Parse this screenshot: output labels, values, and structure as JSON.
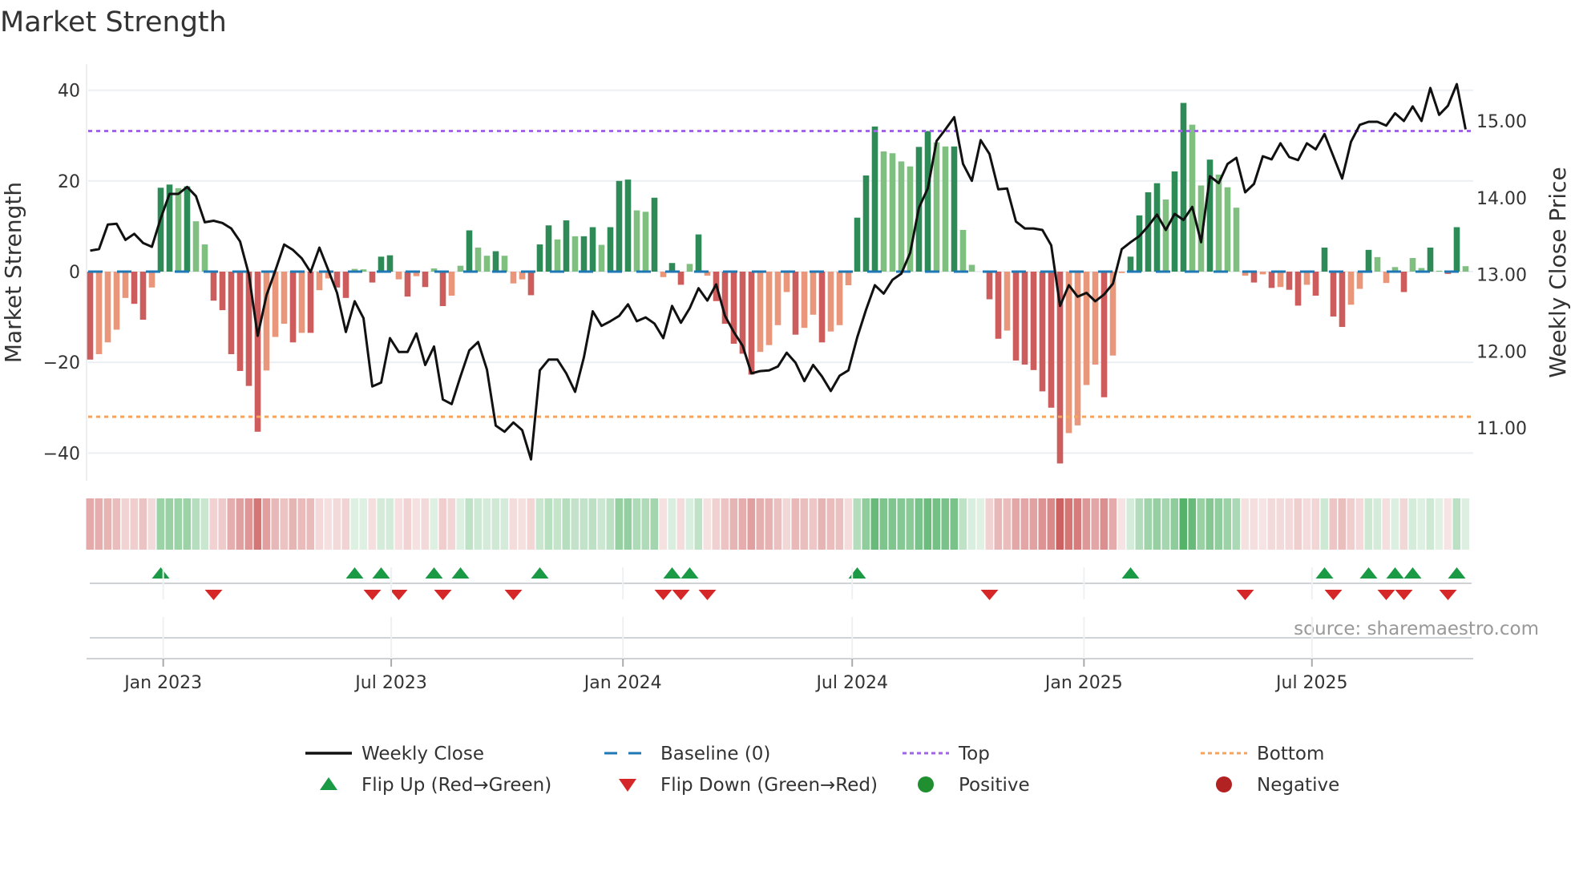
{
  "chart_data": {
    "type": "bar",
    "title": "Market Strength",
    "ylabel": "Market Strength",
    "y2label": "Weekly Close Price",
    "start_date": "2022-11-04",
    "frequency": "weekly",
    "ylim": [
      -46,
      46
    ],
    "y2lim": [
      10.45,
      15.55
    ],
    "yticks": [
      40,
      20,
      0,
      -20,
      -40
    ],
    "ytick_labels": [
      "40",
      "20",
      "0",
      "−20",
      "−40"
    ],
    "y2ticks": [
      15,
      14,
      13,
      12,
      11
    ],
    "y2tick_labels": [
      "15.00",
      "14.00",
      "13.00",
      "12.00",
      "11.00"
    ],
    "xtick_dates": [
      "2023-01-01",
      "2023-07-01",
      "2024-01-01",
      "2024-07-01",
      "2025-01-01",
      "2025-07-01"
    ],
    "xtick_labels": [
      "Jan 2023",
      "Jul 2023",
      "Jan 2024",
      "Jul 2024",
      "Jan 2025",
      "Jul 2025"
    ],
    "top_level": 31,
    "bottom_level": -32,
    "baseline": 0,
    "strength": [
      -19.4,
      -18.2,
      -15.6,
      -12.8,
      -5.8,
      -7.1,
      -10.6,
      -3.5,
      18.5,
      19.2,
      18.4,
      18.8,
      11.1,
      6.0,
      -6.4,
      -8.5,
      -18.2,
      -21.9,
      -25.2,
      -35.3,
      -21.8,
      -14.4,
      -11.5,
      -15.6,
      -13.5,
      -13.5,
      -4.1,
      -1.5,
      -3.5,
      -5.8,
      0.6,
      0.5,
      -2.4,
      3.3,
      3.6,
      -1.7,
      -5.5,
      -1.0,
      -3.4,
      0.7,
      -7.6,
      -5.3,
      1.3,
      9.1,
      5.3,
      3.5,
      4.5,
      3.5,
      -2.6,
      -1.7,
      -5.2,
      6.0,
      10.2,
      7.1,
      11.3,
      7.8,
      7.8,
      9.8,
      5.9,
      9.8,
      20.0,
      20.3,
      13.5,
      13.2,
      16.3,
      -1.2,
      1.9,
      -2.9,
      1.7,
      8.2,
      -0.9,
      -6.5,
      -11.5,
      -15.9,
      -18.1,
      -22.7,
      -17.7,
      -16.2,
      -11.8,
      -4.5,
      -13.9,
      -12.4,
      -9.5,
      -15.6,
      -13.2,
      -11.8,
      -3.0,
      11.9,
      21.2,
      32.0,
      26.5,
      26.1,
      24.3,
      23.2,
      27.5,
      31.0,
      28.5,
      27.6,
      27.6,
      9.2,
      1.5,
      0,
      -6.1,
      -14.8,
      -13.0,
      -19.6,
      -20.5,
      -21.7,
      -26.4,
      -30.0,
      -42.3,
      -35.6,
      -33.9,
      -25.0,
      -20.5,
      -27.7,
      -18.5,
      -0.3,
      3.3,
      12.4,
      17.5,
      19.5,
      15.9,
      22.1,
      37.2,
      32.4,
      19.0,
      24.7,
      21.4,
      18.6,
      14.1,
      -0.9,
      -2.4,
      -0.6,
      -3.6,
      -3.4,
      -4.0,
      -7.5,
      -2.9,
      -5.3,
      5.3,
      -9.9,
      -12.2,
      -7.3,
      -3.8,
      4.8,
      3.2,
      -2.5,
      1.0,
      -4.5,
      3.0,
      0.8,
      5.3,
      0.2,
      -0.5,
      9.8,
      1.2
    ],
    "weekly_close": [
      13.31,
      13.33,
      13.65,
      13.66,
      13.45,
      13.53,
      13.41,
      13.36,
      13.73,
      14.05,
      14.05,
      14.14,
      14.02,
      13.68,
      13.7,
      13.67,
      13.6,
      13.43,
      13.0,
      12.2,
      12.73,
      13.05,
      13.39,
      13.32,
      13.21,
      13.03,
      13.35,
      13.06,
      12.76,
      12.25,
      12.65,
      12.43,
      11.54,
      11.59,
      12.17,
      11.99,
      11.99,
      12.23,
      11.82,
      12.06,
      11.37,
      11.31,
      11.67,
      12.01,
      12.12,
      11.76,
      11.03,
      10.95,
      11.07,
      10.97,
      10.59,
      11.75,
      11.89,
      11.89,
      11.71,
      11.47,
      11.92,
      12.52,
      12.33,
      12.39,
      12.46,
      12.61,
      12.39,
      12.44,
      12.36,
      12.17,
      12.59,
      12.37,
      12.56,
      12.82,
      12.66,
      12.87,
      12.46,
      12.25,
      12.07,
      11.71,
      11.74,
      11.75,
      11.8,
      11.98,
      11.85,
      11.61,
      11.82,
      11.67,
      11.48,
      11.68,
      11.75,
      12.18,
      12.54,
      12.86,
      12.75,
      12.93,
      13.01,
      13.28,
      13.87,
      14.12,
      14.74,
      14.89,
      15.05,
      14.44,
      14.22,
      14.75,
      14.57,
      14.11,
      14.12,
      13.69,
      13.6,
      13.6,
      13.58,
      13.38,
      12.59,
      12.86,
      12.71,
      12.76,
      12.65,
      12.74,
      12.88,
      13.33,
      13.42,
      13.5,
      13.63,
      13.78,
      13.58,
      13.79,
      13.71,
      13.88,
      13.42,
      14.28,
      14.19,
      14.44,
      14.52,
      14.07,
      14.18,
      14.54,
      14.5,
      14.71,
      14.53,
      14.49,
      14.71,
      14.63,
      14.83,
      14.54,
      14.25,
      14.73,
      14.95,
      14.99,
      14.99,
      14.94,
      15.1,
      15.0,
      15.19,
      15.0,
      15.43,
      15.08,
      15.2,
      15.48,
      14.89
    ],
    "legend": {
      "placement": "bottom-center",
      "entries": [
        {
          "key": "weekly_close",
          "label": "Weekly Close"
        },
        {
          "key": "baseline",
          "label": "Baseline (0)"
        },
        {
          "key": "top",
          "label": "Top"
        },
        {
          "key": "bottom",
          "label": "Bottom"
        },
        {
          "key": "flip_up",
          "label": "Flip Up (Red→Green)"
        },
        {
          "key": "flip_down",
          "label": "Flip Down (Green→Red)"
        },
        {
          "key": "positive",
          "label": "Positive"
        },
        {
          "key": "negative",
          "label": "Negative"
        }
      ]
    },
    "source": "source: sharemaestro.com",
    "colors": {
      "pos_strong": "#2e8b57",
      "pos_weak": "#7fbf7f",
      "neg_strong": "#cd5c5c",
      "neg_weak": "#e9967a",
      "line": "#111111",
      "baseline": "#1f77b4",
      "top": "#a064e6",
      "bottom": "#f4a460",
      "flip_up": "#1a9a45",
      "flip_down": "#d62728",
      "positive": "#1f8f2f",
      "negative": "#b22222"
    }
  }
}
